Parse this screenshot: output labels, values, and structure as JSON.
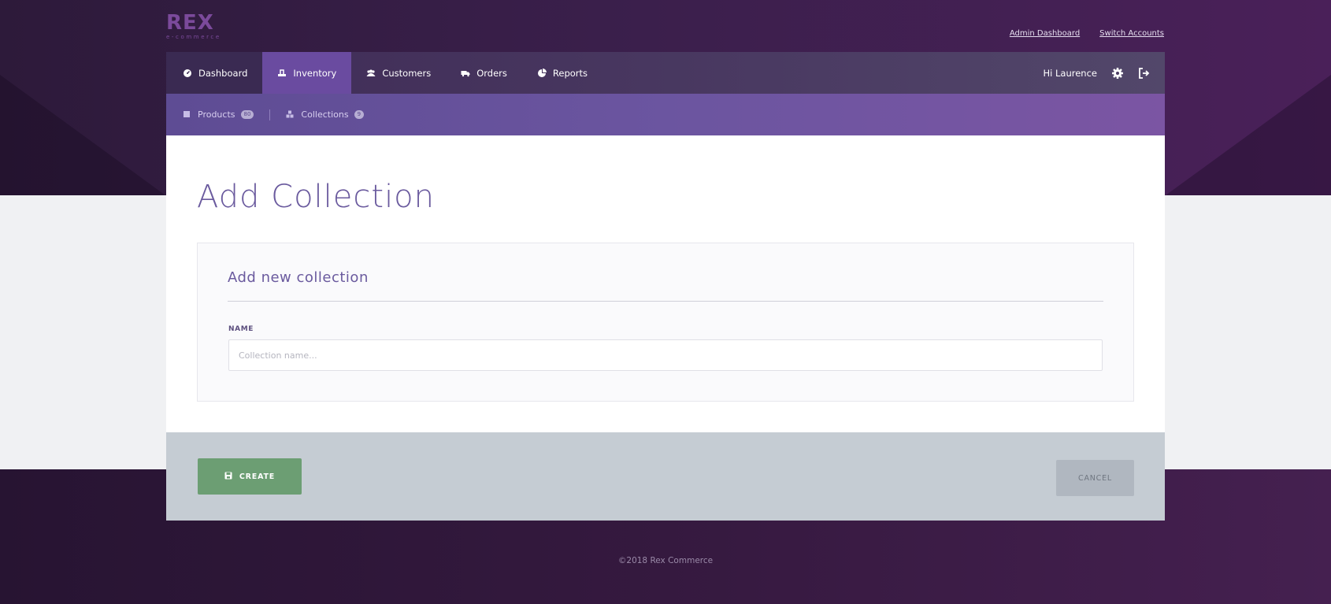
{
  "logo": {
    "text": "REX",
    "sub": "e-commerce"
  },
  "top_links": {
    "admin_dashboard": "Admin Dashboard",
    "switch_accounts": "Switch Accounts"
  },
  "nav": {
    "items": [
      {
        "label": "Dashboard",
        "icon": "dashboard-icon"
      },
      {
        "label": "Inventory",
        "icon": "inventory-icon",
        "active": true
      },
      {
        "label": "Customers",
        "icon": "customers-icon"
      },
      {
        "label": "Orders",
        "icon": "truck-icon"
      },
      {
        "label": "Reports",
        "icon": "pie-chart-icon"
      }
    ],
    "greeting": "Hi Laurence"
  },
  "subnav": {
    "products": {
      "label": "Products",
      "count": "80"
    },
    "collections": {
      "label": "Collections",
      "count": "9"
    }
  },
  "page": {
    "title": "Add Collection"
  },
  "form": {
    "card_title": "Add new collection",
    "name_label": "NAME",
    "name_placeholder": "Collection name...",
    "name_value": ""
  },
  "actions": {
    "create": "CREATE",
    "cancel": "CANCEL"
  },
  "footer": {
    "copyright": "©2018 Rex Commerce"
  },
  "colors": {
    "accent": "#6a4ba0",
    "create_button": "#6c9e73",
    "title": "#6a5a9e"
  }
}
